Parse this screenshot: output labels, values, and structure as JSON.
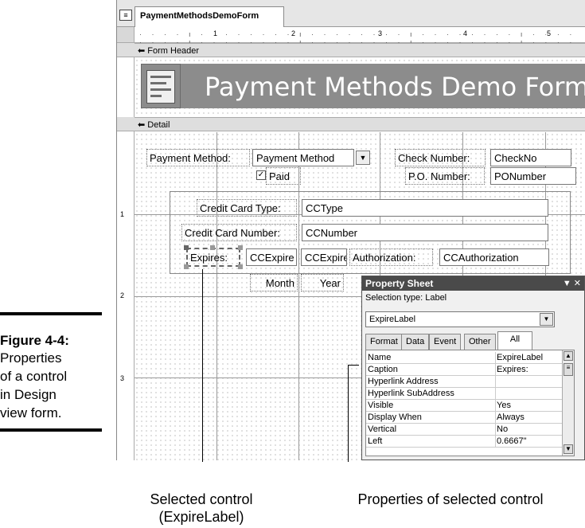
{
  "figure": {
    "number": "Figure 4-4:",
    "caption_lines": [
      "Properties",
      "of a control",
      "in Design",
      "view form."
    ]
  },
  "window": {
    "tab_title": "PaymentMethodsDemoForm",
    "ruler_numbers": [
      "1",
      "2",
      "3",
      "4",
      "5"
    ],
    "vruler_numbers": [
      "1",
      "2",
      "3"
    ]
  },
  "sections": {
    "header_label": "Form Header",
    "detail_label": "Detail"
  },
  "form_header": {
    "title": "Payment Methods Demo Form"
  },
  "controls": {
    "payment_method_label": "Payment Method:",
    "payment_method_combo": "Payment Method",
    "check_number_label": "Check Number:",
    "check_number_box": "CheckNo",
    "paid_label": "Paid",
    "po_number_label": "P.O. Number:",
    "po_number_box": "PONumber",
    "cc_type_label": "Credit Card Type:",
    "cc_type_box": "CCType",
    "cc_number_label": "Credit Card Number:",
    "cc_number_box": "CCNumber",
    "expires_label": "Expires:",
    "cc_expire_month_box": "CCExpire",
    "cc_expire_year_box": "CCExpire",
    "authorization_label": "Authorization:",
    "authorization_box": "CCAuthorization",
    "month_label": "Month",
    "year_label": "Year"
  },
  "property_sheet": {
    "title": "Property Sheet",
    "selection_type": "Selection type: Label",
    "selected_object": "ExpireLabel",
    "tabs": [
      "Format",
      "Data",
      "Event",
      "Other",
      "All"
    ],
    "active_tab": "All",
    "rows": [
      {
        "k": "Name",
        "v": "ExpireLabel"
      },
      {
        "k": "Caption",
        "v": "Expires:"
      },
      {
        "k": "Hyperlink Address",
        "v": ""
      },
      {
        "k": "Hyperlink SubAddress",
        "v": ""
      },
      {
        "k": "Visible",
        "v": "Yes"
      },
      {
        "k": "Display When",
        "v": "Always"
      },
      {
        "k": "Vertical",
        "v": "No"
      },
      {
        "k": "Left",
        "v": "0.6667\""
      }
    ]
  },
  "callouts": {
    "selected_control_line1": "Selected control",
    "selected_control_line2": "(ExpireLabel)",
    "properties_label": "Properties of selected control"
  }
}
